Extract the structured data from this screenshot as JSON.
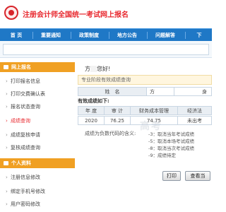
{
  "site_title": "注册会计师全国统一考试网上报名",
  "nav": [
    "首  页",
    "重要通知",
    "政策制度",
    "地方公告",
    "问题解答",
    "下"
  ],
  "sidebar": {
    "section1": "网上报名",
    "items1": [
      "打印报名信息",
      "打印交费确认表",
      "报名状态查询",
      "成绩查询",
      "成绩复核申请",
      "复核成绩查询"
    ],
    "section2": "个人资料",
    "items2": [
      "注册信息修改",
      "绑定手机号修改",
      "用户密码修改"
    ]
  },
  "main": {
    "greeting_prefix": "方",
    "greeting_suffix": "您好!",
    "notice": "专业阶段有效成绩查询",
    "name_label": "姓　名",
    "name_value": "方",
    "extra_header": "身",
    "section_title": "有效成绩如下:",
    "table_headers": [
      "年 度",
      "审 计",
      "财务成本管理",
      "经济法"
    ],
    "table_row": [
      "2020",
      "76.25",
      "74.75",
      "未出考"
    ],
    "notes_label": "成绩为负数代码的含义:",
    "notes": [
      "-3：取消当年考试成绩",
      "-5：取消本场考试成绩",
      "-8：取消当次考试成绩",
      "-9：成绩待定"
    ],
    "buttons": [
      "打印",
      "查看当"
    ]
  },
  "watermark": "高考"
}
